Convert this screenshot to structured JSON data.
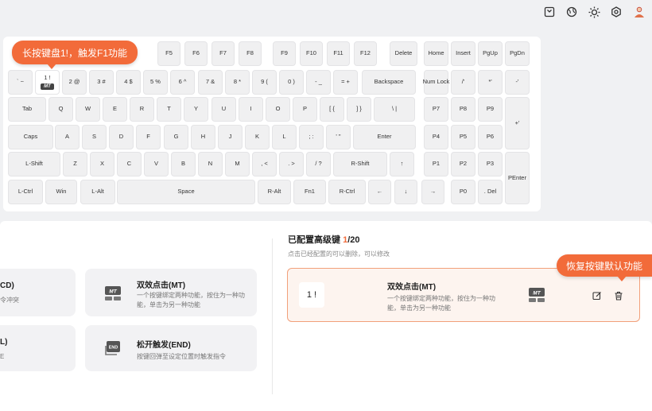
{
  "topbar": {
    "icons": [
      "save-icon",
      "globe-icon",
      "brightness-icon",
      "settings-icon",
      "avatar"
    ]
  },
  "tooltips": {
    "long_press": "长按键盘1!，触发F1功能",
    "restore": "恢复按键默认功能"
  },
  "keyboard": {
    "row0": [
      "F5",
      "F6",
      "F7",
      "F8",
      "F9",
      "F10",
      "F11",
      "F12",
      "Delete",
      "Home",
      "Insert",
      "PgUp",
      "PgDn"
    ],
    "row1": [
      "` ~",
      "1 !",
      "2 @",
      "3 #",
      "4 $",
      "5 %",
      "6 ^",
      "7 &",
      "8 *",
      "9 (",
      "0 )",
      "- _",
      "= +",
      "Backspace",
      "Num Lock",
      "/'",
      "*'",
      "-'"
    ],
    "row2": [
      "Tab",
      "Q",
      "W",
      "E",
      "R",
      "T",
      "Y",
      "U",
      "I",
      "O",
      "P",
      "[ {",
      "] }",
      "\\ |",
      "P7",
      "P8",
      "P9",
      "+'"
    ],
    "row3": [
      "Caps",
      "A",
      "S",
      "D",
      "F",
      "G",
      "H",
      "J",
      "K",
      "L",
      "; :",
      "' \"",
      "Enter",
      "P4",
      "P5",
      "P6"
    ],
    "row4": [
      "L-Shift",
      "Z",
      "X",
      "C",
      "V",
      "B",
      "N",
      "M",
      ", <",
      ". >",
      "/ ?",
      "R-Shift",
      "↑",
      "P1",
      "P2",
      "P3",
      "PEnter"
    ],
    "row5": [
      "L-Ctrl",
      "Win",
      "L-Alt",
      "Space",
      "R-Alt",
      "Fn1",
      "R-Ctrl",
      "←",
      "↓",
      "→",
      "P0",
      ". Del"
    ],
    "selected_badge": "MT"
  },
  "features": [
    {
      "title": "CD)",
      "desc": "令冲突"
    },
    {
      "title": "双效点击(MT)",
      "desc": "一个按键绑定两种功能，按住为一种功能，单击为另一种功能"
    },
    {
      "title": "L)",
      "desc": "E"
    },
    {
      "title": "松开触发(END)",
      "desc": "按键回弹至设定位置时触发指令"
    }
  ],
  "configured": {
    "title_prefix": "已配置高级键 ",
    "count": "1",
    "total": "/20",
    "subtitle": "点击已经配置的可以删除，可以修改",
    "item": {
      "key": "1 !",
      "title": "双效点击(MT)",
      "desc": "一个按键绑定两种功能，按住为一种功能，单击为另一种功能"
    }
  },
  "colors": {
    "accent": "#f26b3a"
  }
}
